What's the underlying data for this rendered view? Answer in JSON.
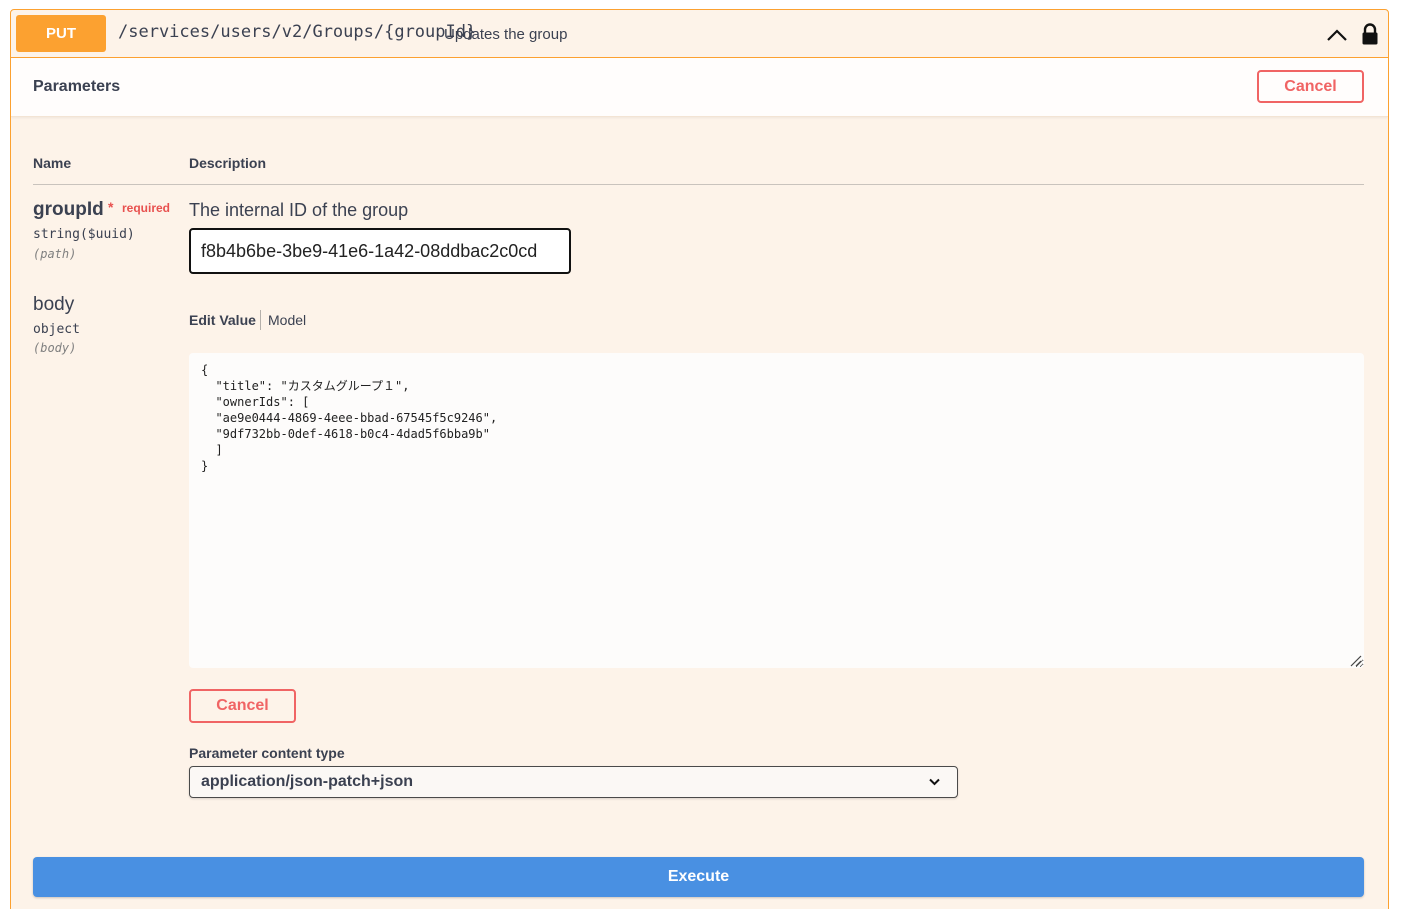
{
  "operation": {
    "method": "PUT",
    "path": "/services/users/v2/Groups/{groupId}",
    "description": "Updates the group",
    "collapse_icon": "chevron-up-icon",
    "auth_icon": "lock-icon"
  },
  "parameters": {
    "title": "Parameters",
    "cancel_label": "Cancel",
    "columns": {
      "name": "Name",
      "description": "Description"
    },
    "groupId": {
      "name": "groupId",
      "required_star": "*",
      "required_label": "required",
      "type": "string($uuid)",
      "in": "(path)",
      "description": "The internal ID of the group",
      "value": "f8b4b6be-3be9-41e6-1a42-08ddbac2c0cd"
    },
    "body": {
      "name": "body",
      "type": "object",
      "in": "(body)",
      "tabs": {
        "edit": "Edit Value",
        "model": "Model"
      },
      "value": "{\n  \"title\": \"カスタムグループ１\",\n  \"ownerIds\": [\n  \"ae9e0444-4869-4eee-bbad-67545f5c9246\",\n  \"9df732bb-0def-4618-b0c4-4dad5f6bba9b\"\n  ]\n}",
      "cancel_label": "Cancel"
    },
    "content_type": {
      "label": "Parameter content type",
      "selected": "application/json-patch+json"
    }
  },
  "execute_label": "Execute",
  "colors": {
    "put": "#fca130",
    "cancel": "#f06464",
    "execute": "#4990e2",
    "required": "#e8514f"
  }
}
